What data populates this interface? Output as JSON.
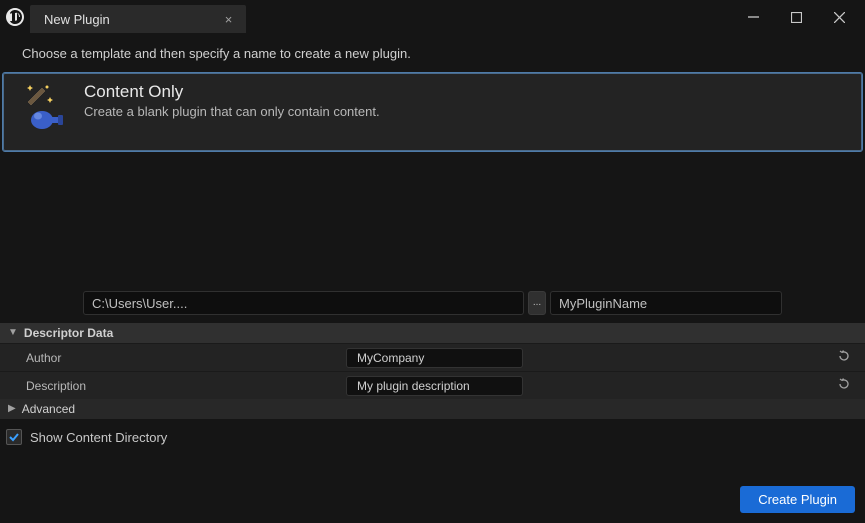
{
  "titlebar": {
    "tab_title": "New Plugin"
  },
  "instruction": "Choose a template and then specify a name to create a new plugin.",
  "template": {
    "title": "Content Only",
    "description": "Create a blank plugin that can only contain content."
  },
  "path": {
    "value": "C:\\Users\\User...."
  },
  "browse_label": "...",
  "plugin_name": {
    "value": "MyPluginName"
  },
  "sections": {
    "descriptor_label": "Descriptor Data",
    "advanced_label": "Advanced"
  },
  "props": {
    "author_label": "Author",
    "author_value": "MyCompany",
    "description_label": "Description",
    "description_value": "My plugin description"
  },
  "show_content_directory_label": "Show Content Directory",
  "create_button_label": "Create Plugin"
}
